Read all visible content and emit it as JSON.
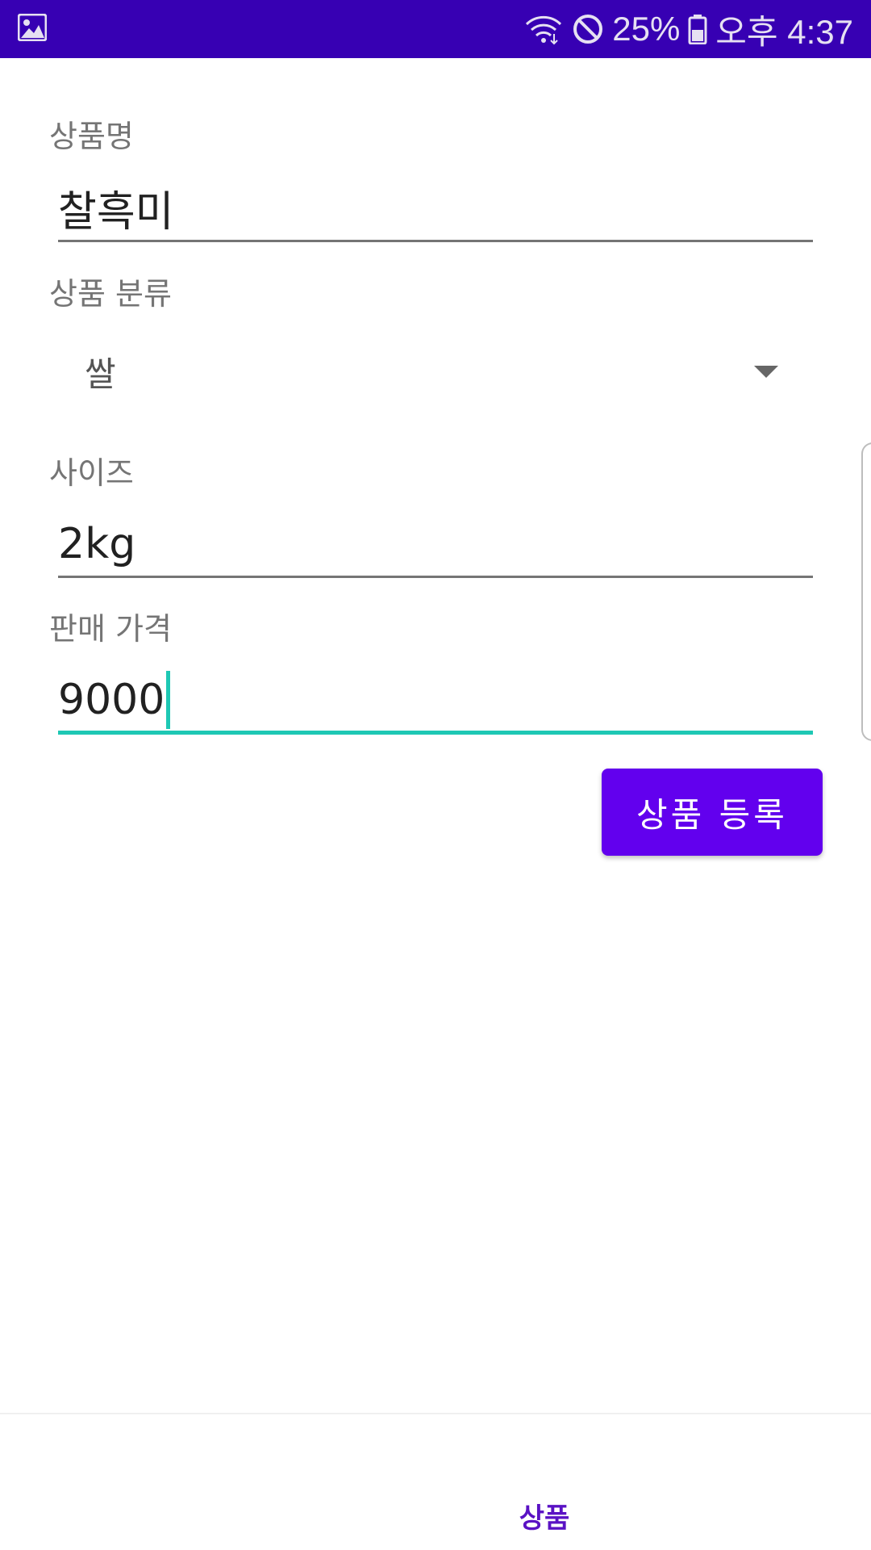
{
  "status_bar": {
    "left_icon": "image-icon",
    "icons": [
      "wifi-icon",
      "do-not-disturb-icon",
      "battery-icon"
    ],
    "battery": "25%",
    "time": "오후 4:37",
    "bg_color": "#3700b3"
  },
  "form": {
    "product_name": {
      "label": "상품명",
      "value": "찰흑미"
    },
    "category": {
      "label": "상품 분류",
      "value": "쌀"
    },
    "size": {
      "label": "사이즈",
      "value": "2kg"
    },
    "price": {
      "label": "판매 가격",
      "value": "9000"
    }
  },
  "actions": {
    "register_label": "상품 등록",
    "accent_color": "#6200ee"
  },
  "bottom_nav": {
    "items": [
      {
        "label": "상품"
      }
    ]
  }
}
